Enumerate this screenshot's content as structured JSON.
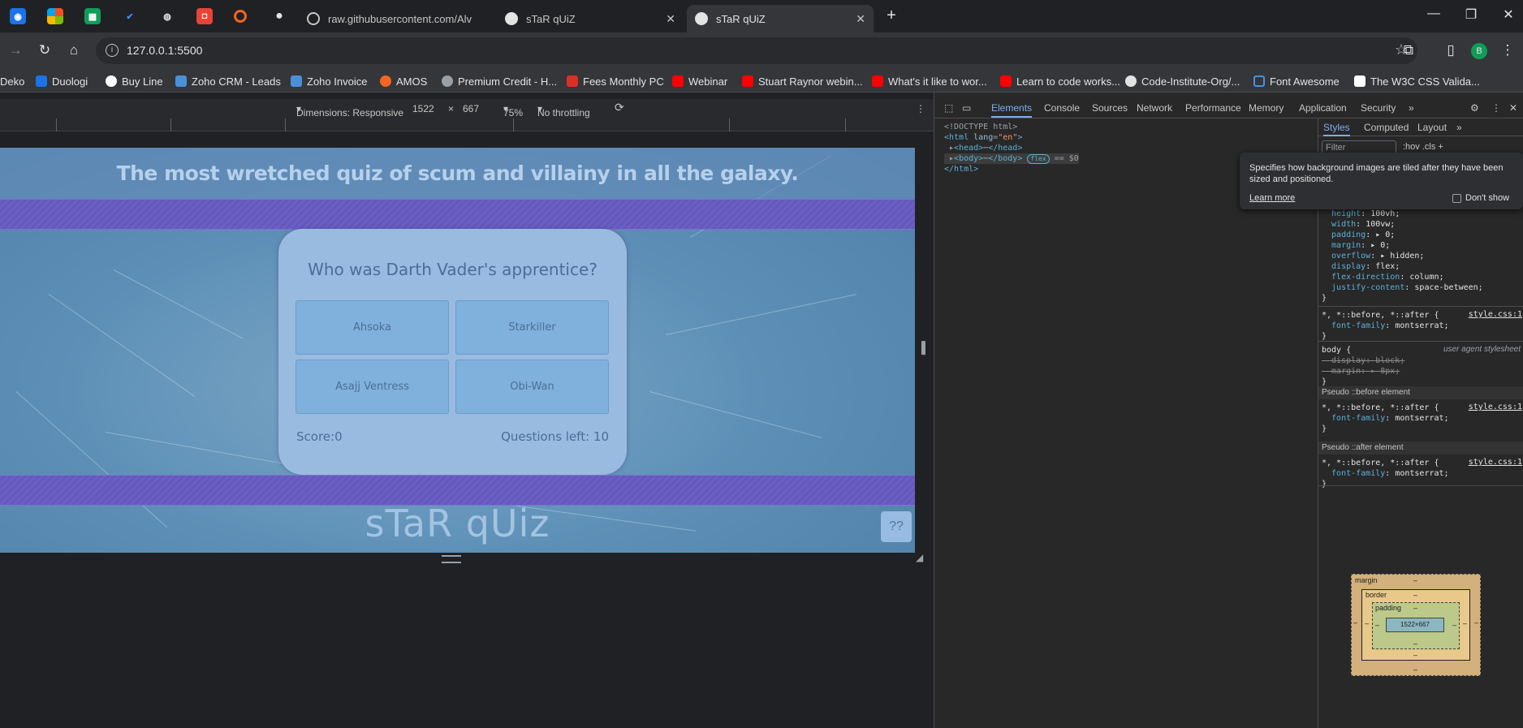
{
  "browser": {
    "tabs": [
      {
        "title": "raw.githubusercontent.com/Alv"
      },
      {
        "title": "sTaR qUiZ"
      },
      {
        "title": "sTaR qUiZ"
      }
    ],
    "url": "127.0.0.1:5500",
    "profile_initial": "B",
    "bookmarks": [
      "Deko",
      "Duologi",
      "Buy Line",
      "Zoho CRM - Leads",
      "Zoho Invoice",
      "AMOS",
      "Premium Credit - H...",
      "Fees Monthly PC",
      "Webinar",
      "Stuart Raynor webin...",
      "What's it like to wor...",
      "Learn to code works...",
      "Code-Institute-Org/...",
      "Font Awesome",
      "The W3C CSS Valida..."
    ]
  },
  "device_toolbar": {
    "dimensions_label": "Dimensions: Responsive",
    "width": "1522",
    "times": "×",
    "height": "667",
    "zoom": "75%",
    "throttling": "No throttling"
  },
  "quiz": {
    "heading": "The most wretched quiz of scum and villainy in all the galaxy.",
    "question": "Who was Darth Vader's apprentice?",
    "answers": [
      "Ahsoka",
      "Starkiller",
      "Asajj Ventress",
      "Obi-Wan"
    ],
    "score": "Score:0",
    "questions_left": "Questions left: 10",
    "brand": "sTaR qUiz",
    "help": "??"
  },
  "devtools": {
    "tabs": [
      "Elements",
      "Console",
      "Sources",
      "Network",
      "Performance",
      "Memory",
      "Application",
      "Security"
    ],
    "styles_tabs": [
      "Styles",
      "Computed",
      "Layout"
    ],
    "filter_placeholder": "Filter",
    "hov": ":hov",
    "cls": ".cls",
    "tooltip_text": "Specifies how background images are tiled after they have been sized and positioned.",
    "tooltip_learn": "Learn more",
    "tooltip_dont_show": "Don't show",
    "pseudo_before": "Pseudo ::before element",
    "pseudo_after": "Pseudo ::after element",
    "source": "style.css:1",
    "ua_label": "user agent stylesheet",
    "box_margin": "margin",
    "box_border": "border",
    "box_padding": "padding",
    "box_content": "1522×667",
    "box_dash": "–"
  }
}
